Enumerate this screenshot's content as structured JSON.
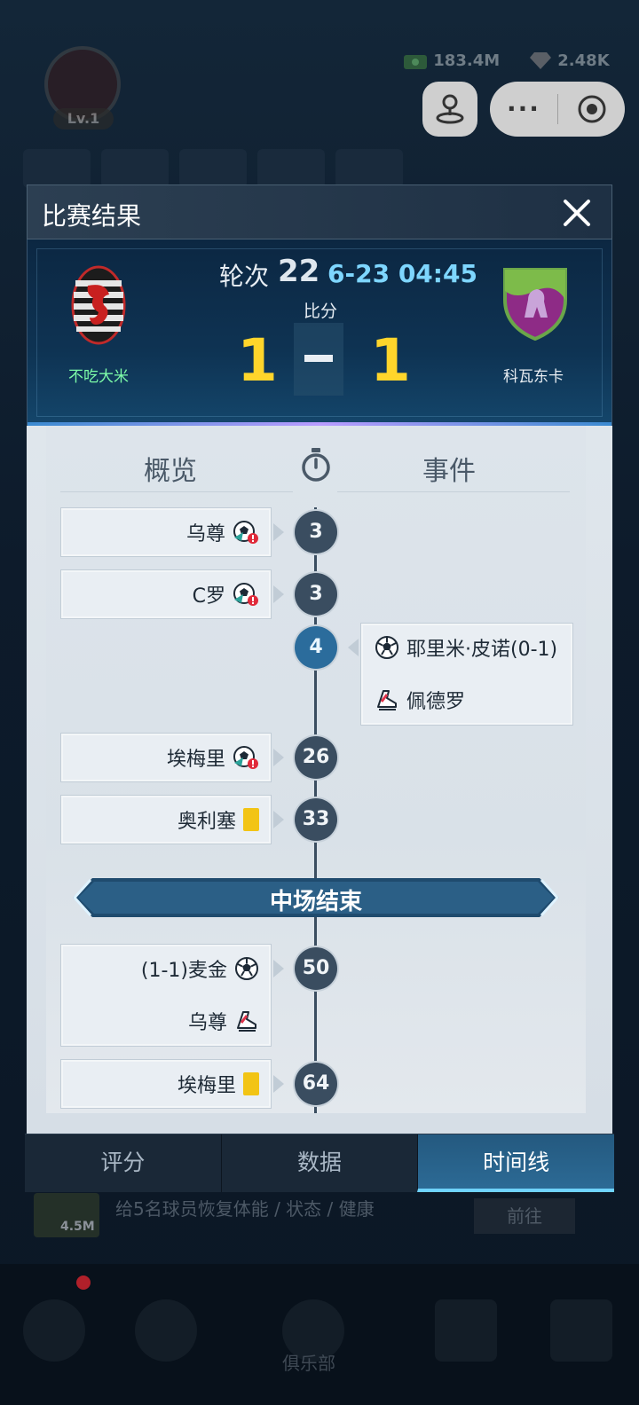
{
  "background": {
    "level": "Lv.1",
    "cash": "183.4M",
    "gems": "2.48K",
    "task_reward": "4.5M",
    "task_text": "给5名球员恢复体能 / 状态 / 健康",
    "task_button": "前往",
    "nav_label": "俱乐部"
  },
  "capsule": {
    "dots": "···"
  },
  "modal": {
    "title": "比赛结果",
    "close_icon": "close-icon"
  },
  "match": {
    "round_label": "轮次",
    "round_number": "22",
    "date": "6-23 04:45",
    "score_label": "比分",
    "home_team": "不吃大米",
    "away_team": "科瓦东卡",
    "home_score": "1",
    "away_score": "1",
    "colors": {
      "home_name": "#7dfca8",
      "score": "#ffd52b",
      "date": "#7ed6ff"
    }
  },
  "timeline": {
    "col_overview": "概览",
    "col_events": "事件",
    "halftime": "中场结束",
    "events": [
      {
        "minute": "3",
        "side": "home",
        "rows": [
          {
            "name": "乌尊",
            "icon": "injury-ball-icon"
          }
        ]
      },
      {
        "minute": "3",
        "side": "home",
        "rows": [
          {
            "name": "C罗",
            "icon": "injury-ball-icon"
          }
        ]
      },
      {
        "minute": "4",
        "side": "away",
        "rows": [
          {
            "name": "耶里米·皮诺(0-1)",
            "icon": "soccer-ball-icon"
          },
          {
            "name": "佩德罗",
            "icon": "boot-icon"
          }
        ]
      },
      {
        "minute": "26",
        "side": "home",
        "rows": [
          {
            "name": "埃梅里",
            "icon": "injury-ball-icon"
          }
        ]
      },
      {
        "minute": "33",
        "side": "home",
        "rows": [
          {
            "name": "奥利塞",
            "icon": "yellow-card-icon"
          }
        ]
      },
      {
        "minute": "50",
        "side": "home",
        "rows": [
          {
            "name": "(1-1)麦金",
            "icon": "soccer-ball-icon"
          },
          {
            "name": "乌尊",
            "icon": "boot-icon"
          }
        ]
      },
      {
        "minute": "64",
        "side": "home",
        "rows": [
          {
            "name": "埃梅里",
            "icon": "yellow-card-icon"
          }
        ]
      }
    ]
  },
  "tabs": [
    {
      "label": "评分",
      "active": false
    },
    {
      "label": "数据",
      "active": false
    },
    {
      "label": "时间线",
      "active": true
    }
  ]
}
